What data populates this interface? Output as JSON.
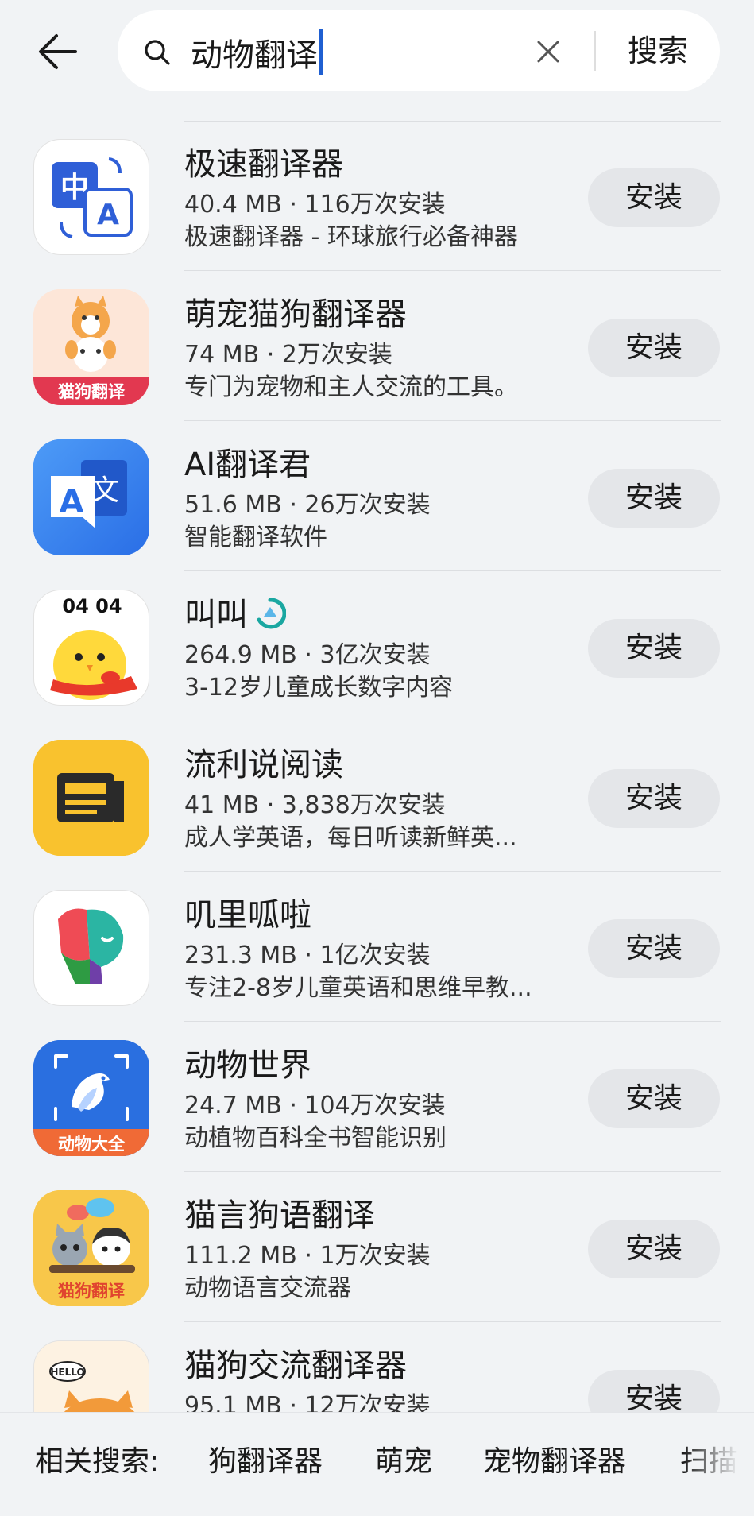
{
  "search": {
    "query": "动物翻译",
    "submit_label": "搜索"
  },
  "apps": [
    {
      "name": "极速翻译器",
      "meta": "40.4 MB · 116万次安装",
      "desc": "极速翻译器 - 环球旅行必备神器",
      "install": "安装",
      "icon": "translate-zh-a-icon"
    },
    {
      "name": "萌宠猫狗翻译器",
      "meta": "74 MB · 2万次安装",
      "desc": "专门为宠物和主人交流的工具。",
      "install": "安装",
      "icon": "cat-dog-translator-icon",
      "icon_text": "猫狗翻译"
    },
    {
      "name": "AI翻译君",
      "meta": "51.6 MB · 26万次安装",
      "desc": "智能翻译软件",
      "install": "安装",
      "icon": "ai-translate-icon"
    },
    {
      "name": "叫叫",
      "meta": "264.9 MB · 3亿次安装",
      "desc": "3-12岁儿童成长数字内容",
      "install": "安装",
      "icon": "chick-icon",
      "icon_text": "04 04"
    },
    {
      "name": "流利说阅读",
      "meta": "41 MB · 3,838万次安装",
      "desc": "成人学英语，每日听读新鲜英...",
      "install": "安装",
      "icon": "newspaper-icon"
    },
    {
      "name": "叽里呱啦",
      "meta": "231.3 MB · 1亿次安装",
      "desc": "专注2-8岁儿童英语和思维早教...",
      "install": "安装",
      "icon": "parrot-icon"
    },
    {
      "name": "动物世界",
      "meta": "24.7 MB · 104万次安装",
      "desc": "动植物百科全书智能识别",
      "install": "安装",
      "icon": "bird-scan-icon",
      "icon_text": "动物大全"
    },
    {
      "name": "猫言狗语翻译",
      "meta": "111.2 MB · 1万次安装",
      "desc": "动物语言交流器",
      "install": "安装",
      "icon": "cat-dog-chat-icon",
      "icon_text": "猫狗翻译"
    },
    {
      "name": "猫狗交流翻译器",
      "meta": "95.1 MB · 12万次安装",
      "desc": "",
      "install": "安装",
      "icon": "hello-cat-icon",
      "icon_text": "HELLO"
    }
  ],
  "related": {
    "label": "相关搜索:",
    "items": [
      "狗翻译器",
      "萌宠",
      "宠物翻译器",
      "扫描"
    ]
  },
  "colors": {
    "background": "#f1f3f5",
    "caret": "#1f5fd1",
    "install_button": "#e4e6e9"
  }
}
